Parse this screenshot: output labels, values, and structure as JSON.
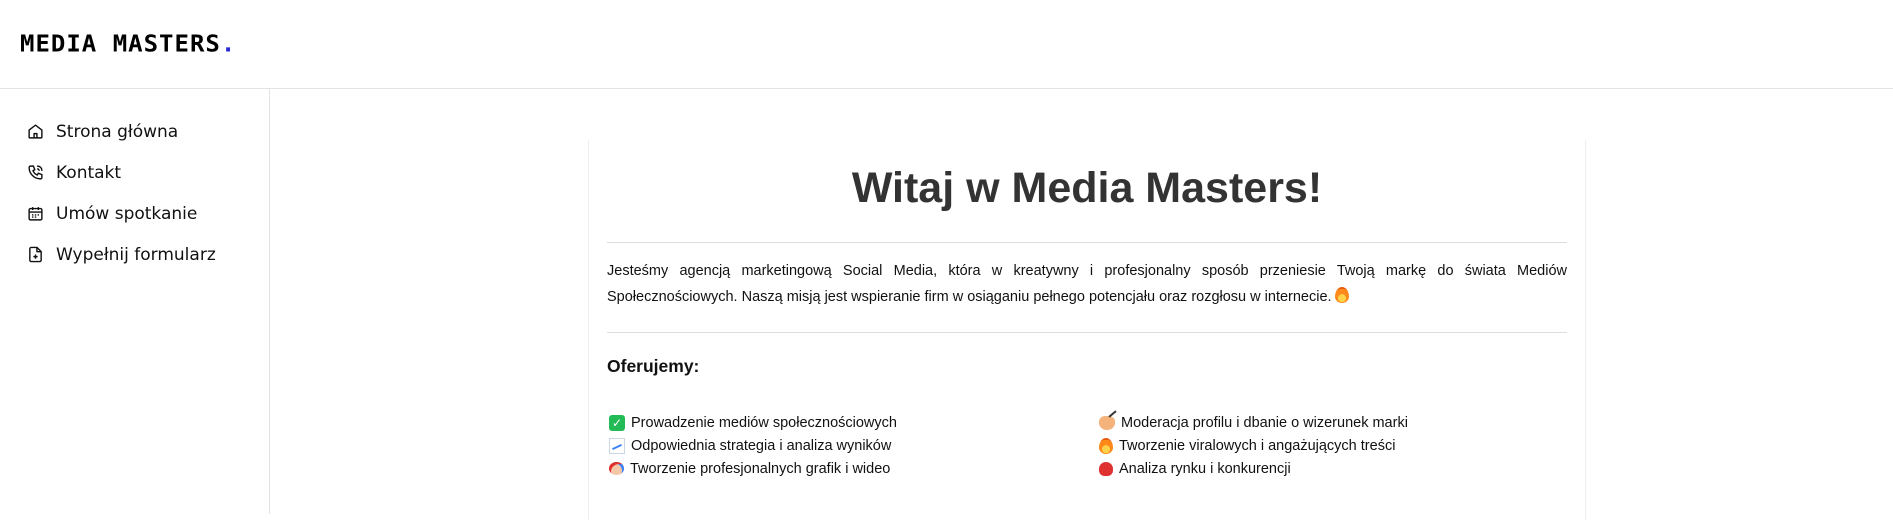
{
  "header": {
    "logo_text": "MEDIA MASTERS",
    "logo_dot": ".",
    "accent_color": "#2a2ad6"
  },
  "sidebar": {
    "items": [
      {
        "label": "Strona główna",
        "icon": "home-icon"
      },
      {
        "label": "Kontakt",
        "icon": "phone-icon"
      },
      {
        "label": "Umów spotkanie",
        "icon": "calendar-icon"
      },
      {
        "label": "Wypełnij formularz",
        "icon": "file-plus-icon"
      }
    ]
  },
  "main": {
    "title": "Witaj w Media Masters!",
    "intro": "Jesteśmy agencją marketingową Social Media, która w kreatywny i profesjonalny sposób przeniesie Twoją markę do świata Mediów Społecznościowych. Naszą misją jest wspieranie firm w osiąganiu pełnego potencjału oraz rozgłosu w internecie.",
    "intro_emoji": "fire-emoji",
    "offer_heading": "Oferujemy:",
    "offers": [
      {
        "text": "Prowadzenie mediów społecznościowych",
        "icon": "check-mark-emoji"
      },
      {
        "text": "Moderacja profilu i dbanie o wizerunek marki",
        "icon": "writing-hand-emoji"
      },
      {
        "text": "Odpowiednia strategia i analiza wyników",
        "icon": "chart-increasing-emoji"
      },
      {
        "text": "Tworzenie viralowych i angażujących treści",
        "icon": "fire-emoji"
      },
      {
        "text": "Tworzenie profesjonalnych grafik i wideo",
        "icon": "palette-emoji"
      },
      {
        "text": "Analiza rynku i konkurencji",
        "icon": "boxing-glove-emoji"
      }
    ]
  }
}
